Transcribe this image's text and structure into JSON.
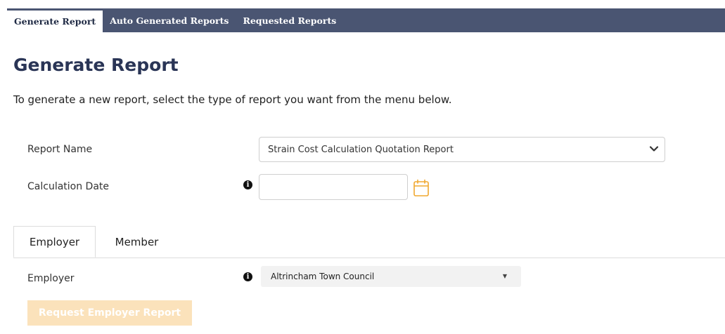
{
  "tabs": [
    {
      "label": "Generate Report",
      "active": true
    },
    {
      "label": "Auto Generated Reports",
      "active": false
    },
    {
      "label": "Requested Reports",
      "active": false
    }
  ],
  "page": {
    "title": "Generate Report",
    "intro": "To generate a new report, select the type of report you want from the menu below."
  },
  "form": {
    "report_name_label": "Report Name",
    "report_name_value": "Strain Cost Calculation Quotation Report",
    "calc_date_label": "Calculation Date",
    "calc_date_value": ""
  },
  "subtabs": [
    {
      "label": "Employer",
      "active": true
    },
    {
      "label": "Member",
      "active": false
    }
  ],
  "employer": {
    "label": "Employer",
    "value": "Altrincham Town Council",
    "button": "Request Employer Report"
  },
  "icons": {
    "info": "info-icon",
    "calendar": "calendar-icon",
    "chevron": "chevron-down-icon"
  },
  "colors": {
    "tabbar": "#4a5572",
    "title": "#2a3556",
    "calendar": "#f0a830",
    "button_disabled": "#fbe2bb"
  }
}
